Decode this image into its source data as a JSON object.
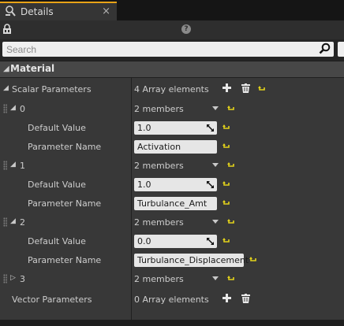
{
  "tab": {
    "title": "Details",
    "close": "×"
  },
  "search": {
    "placeholder": "Search"
  },
  "category": {
    "label": "Material"
  },
  "scalar": {
    "label": "Scalar Parameters",
    "count": "4 Array elements"
  },
  "elements": [
    {
      "index": "0",
      "members": "2 members",
      "default_label": "Default Value",
      "default_value": "1.0",
      "param_label": "Parameter Name",
      "param_value": "Activation"
    },
    {
      "index": "1",
      "members": "2 members",
      "default_label": "Default Value",
      "default_value": "1.0",
      "param_label": "Parameter Name",
      "param_value": "Turbulance_Amt"
    },
    {
      "index": "2",
      "members": "2 members",
      "default_label": "Default Value",
      "default_value": "0.0",
      "param_label": "Parameter Name",
      "param_value": "Turbulance_Displacement"
    },
    {
      "index": "3",
      "members": "2 members"
    }
  ],
  "vector": {
    "label": "Vector Parameters",
    "count": "0 Array elements"
  },
  "colors": {
    "accent": "#e8a317",
    "reset_arrow": "#e3d21a",
    "panel": "#383838"
  }
}
